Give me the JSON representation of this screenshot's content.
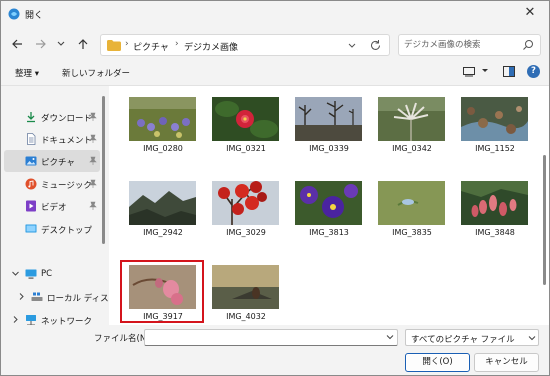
{
  "window": {
    "title": "開く",
    "close_label": "✕"
  },
  "nav": {
    "back_icon": "back-arrow-icon",
    "forward_icon": "forward-arrow-icon",
    "recent_icon": "chevron-down-icon",
    "up_icon": "up-arrow-icon"
  },
  "address": {
    "crumbs": [
      "ピクチャ",
      "デジカメ画像"
    ],
    "separator": "›"
  },
  "search": {
    "placeholder": "デジカメ画像の検索"
  },
  "toolbar": {
    "organize_label": "整理 ▾",
    "new_folder_label": "新しいフォルダー"
  },
  "sidebar": {
    "items": [
      {
        "label": "ダウンロード",
        "icon": "download-icon",
        "pinned": true
      },
      {
        "label": "ドキュメント",
        "icon": "document-icon",
        "pinned": true
      },
      {
        "label": "ピクチャ",
        "icon": "pictures-icon",
        "pinned": true,
        "selected": true
      },
      {
        "label": "ミュージック",
        "icon": "music-icon",
        "pinned": true
      },
      {
        "label": "ビデオ",
        "icon": "video-icon",
        "pinned": true
      },
      {
        "label": "デスクトップ",
        "icon": "desktop-icon",
        "pinned": false
      },
      {
        "label": "PC",
        "icon": "pc-icon",
        "expander": "expanded"
      },
      {
        "label": "ローカル ディスク",
        "icon": "disk-icon",
        "expander": "collapsed"
      },
      {
        "label": "ネットワーク",
        "icon": "network-icon",
        "expander": "collapsed"
      }
    ],
    "pin_glyph": "📌"
  },
  "files": [
    {
      "name": "IMG_0280"
    },
    {
      "name": "IMG_0321"
    },
    {
      "name": "IMG_0339"
    },
    {
      "name": "IMG_0342"
    },
    {
      "name": "IMG_1152"
    },
    {
      "name": "IMG_2942"
    },
    {
      "name": "IMG_3029"
    },
    {
      "name": "IMG_3813"
    },
    {
      "name": "IMG_3835"
    },
    {
      "name": "IMG_3848"
    },
    {
      "name": "IMG_3917",
      "highlighted": true
    },
    {
      "name": "IMG_4032"
    }
  ],
  "bottom": {
    "filename_label": "ファイル名(N):",
    "filename_value": "",
    "filetype_value": "すべてのピクチャ ファイル",
    "open_label": "開く(O)",
    "cancel_label": "キャンセル"
  },
  "colors": {
    "highlight": "#d4141c",
    "accent": "#1a5fb4",
    "folder": "#e8b339"
  }
}
